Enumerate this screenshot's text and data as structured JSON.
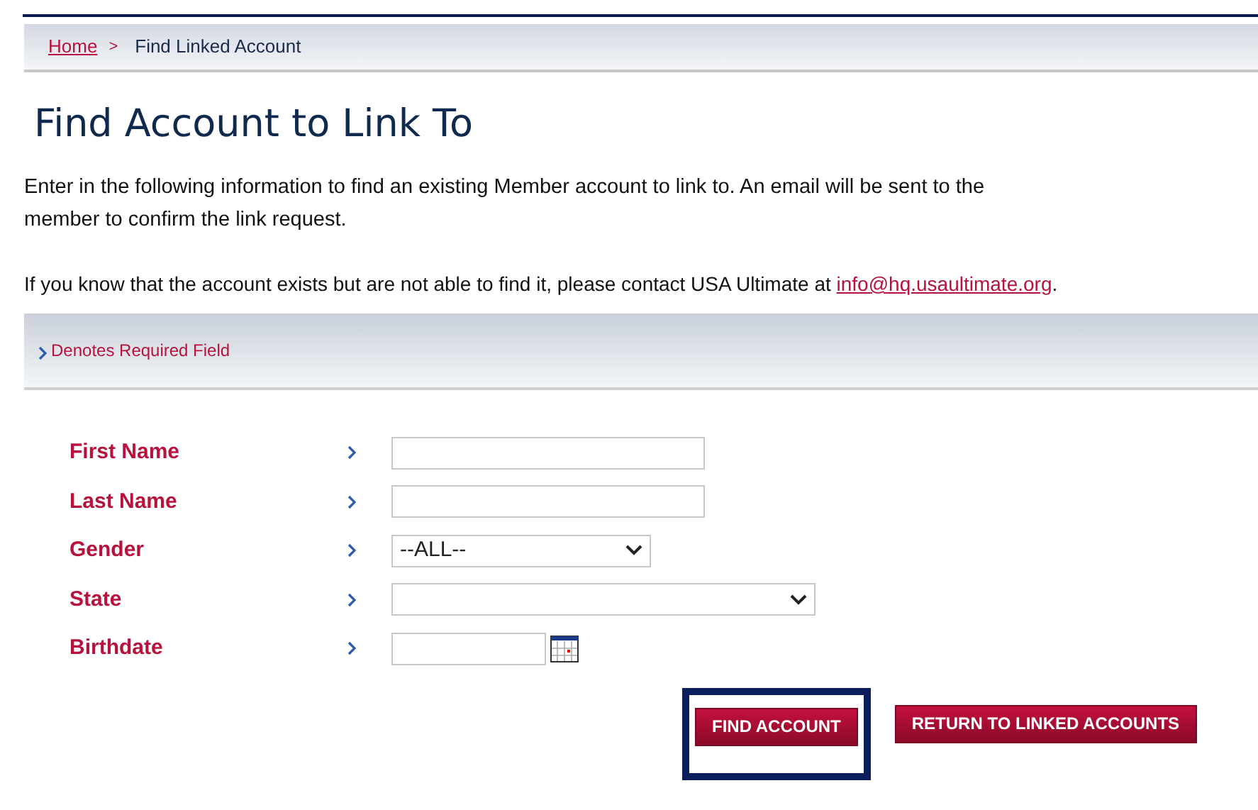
{
  "breadcrumb": [
    {
      "label": "Home",
      "kind": "link"
    },
    {
      "label": ">",
      "kind": "separator"
    },
    {
      "label": "Find Linked Account",
      "kind": "current"
    }
  ],
  "title": "Find Account to Link To",
  "intro": "Enter in the following information to find an existing Member account to link to. An email will be sent to the member to confirm the link request.",
  "contact": {
    "text": "If you know that the account exists but are not able to find it, please contact USA Ultimate at",
    "link": "info@hq.usaultimate.org",
    "after": "."
  },
  "required_note": "Denotes Required Field",
  "fields": [
    {
      "label": "First Name",
      "kind": "text"
    },
    {
      "label": "Last Name",
      "kind": "text"
    },
    {
      "label": "Gender",
      "kind": "select",
      "value": "--ALL--"
    },
    {
      "label": "State",
      "kind": "wide-select"
    },
    {
      "label": "Birthdate",
      "kind": "date"
    }
  ],
  "buttons": [
    {
      "label": "FIND ACCOUNT",
      "highlighted": true
    },
    {
      "label": "RETURN TO LINKED ACCOUNTS",
      "highlighted": false
    }
  ]
}
